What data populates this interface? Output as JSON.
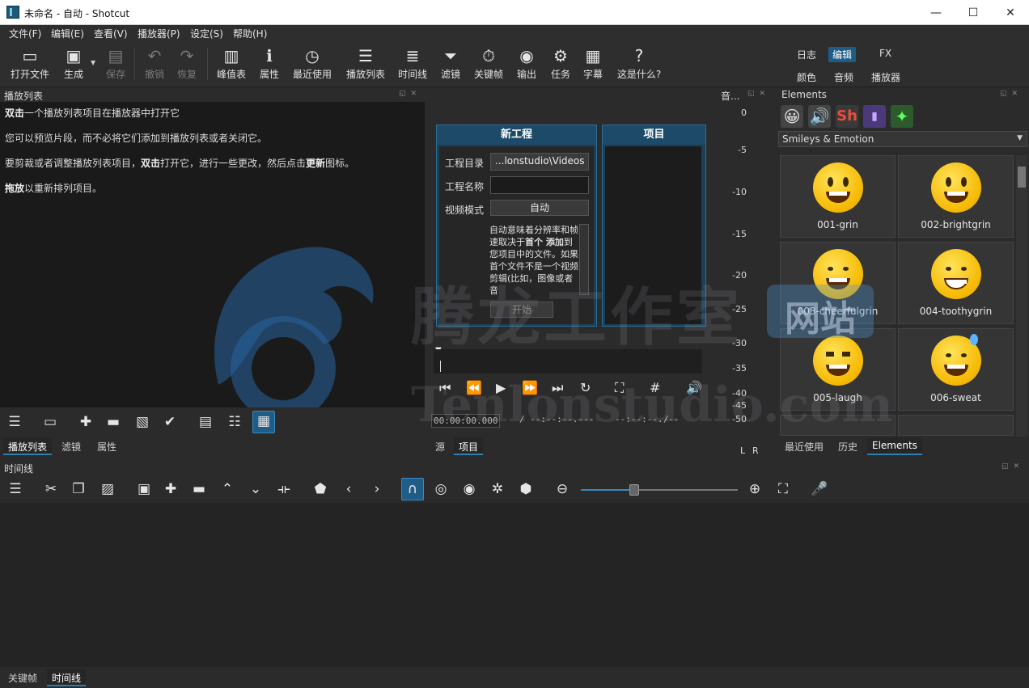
{
  "window": {
    "title": "未命名 - 自动 - Shotcut",
    "controls": [
      "—",
      "☐",
      "✕"
    ]
  },
  "menu": [
    "文件(F)",
    "编辑(E)",
    "查看(V)",
    "播放器(P)",
    "设定(S)",
    "帮助(H)"
  ],
  "toolbar": {
    "buttons": [
      {
        "label": "打开文件",
        "icon": "open-file-icon",
        "enabled": true
      },
      {
        "label": "生成",
        "icon": "generate-icon",
        "enabled": true
      },
      {
        "label": "保存",
        "icon": "save-icon",
        "enabled": false
      },
      {
        "label": "撤销",
        "icon": "undo-icon",
        "enabled": false
      },
      {
        "label": "恢复",
        "icon": "redo-icon",
        "enabled": false
      },
      {
        "label": "峰值表",
        "icon": "peak-meter-icon",
        "enabled": true
      },
      {
        "label": "属性",
        "icon": "properties-icon",
        "enabled": true
      },
      {
        "label": "最近使用",
        "icon": "recent-icon",
        "enabled": true
      },
      {
        "label": "播放列表",
        "icon": "playlist-icon",
        "enabled": true
      },
      {
        "label": "时间线",
        "icon": "timeline-icon",
        "enabled": true
      },
      {
        "label": "滤镜",
        "icon": "filter-icon",
        "enabled": true
      },
      {
        "label": "关键帧",
        "icon": "keyframe-icon",
        "enabled": true
      },
      {
        "label": "输出",
        "icon": "export-icon",
        "enabled": true
      },
      {
        "label": "任务",
        "icon": "jobs-icon",
        "enabled": true
      },
      {
        "label": "字幕",
        "icon": "subtitles-icon",
        "enabled": true
      },
      {
        "label": "这是什么?",
        "icon": "help-icon",
        "enabled": true
      }
    ],
    "layouts_top": [
      "日志",
      "编辑",
      "FX"
    ],
    "layouts_bottom": [
      "颜色",
      "音频",
      "播放器"
    ],
    "active_layout": "编辑"
  },
  "playlist": {
    "title": "播放列表",
    "lines": [
      {
        "bold": "双击",
        "rest": "一个播放列表项目在播放器中打开它"
      },
      {
        "bold": "",
        "rest": "您可以预览片段，而不必将它们添加到播放列表或者关闭它。"
      },
      {
        "pre": "要剪裁或者调整播放列表项目，",
        "bold": "双击",
        "mid": "打开它，进行一些更改，然后点击",
        "bold2": "更新",
        "post": "图标。"
      },
      {
        "bold": "拖放",
        "rest": "以重新排列项目。"
      }
    ],
    "tabs": [
      "播放列表",
      "滤镜",
      "属性"
    ]
  },
  "new_project": {
    "title": "新工程",
    "dir_label": "工程目录",
    "dir_value": "...lonstudio\\Videos",
    "name_label": "工程名称",
    "name_value": "",
    "mode_label": "视频模式",
    "mode_value": "自动",
    "info_text_a": "自动意味着分辨率和帧速取决于",
    "info_bold_a": "首个 添加",
    "info_text_b": "到您项目中的文件。如果首个文件不是一个视频剪辑(比如，图像或者音",
    "start_label": "开始",
    "projects_title": "项目"
  },
  "player": {
    "tabs": [
      "源",
      "项目"
    ],
    "timecode": "00:00:00.000",
    "duration": "--:--:--.---",
    "in_out": "--:--:--.---",
    "slash": "/"
  },
  "meter": {
    "title": "音...",
    "ticks": [
      "0",
      "-5",
      "-10",
      "-15",
      "-20",
      "-25",
      "-30",
      "-35",
      "-40",
      "-45",
      "-50"
    ],
    "channels": [
      "L",
      "R"
    ]
  },
  "elements": {
    "title": "Elements",
    "category": "Smileys & Emotion",
    "items": [
      {
        "name": "001-grin"
      },
      {
        "name": "002-brightgrin"
      },
      {
        "name": "003-cheerfulgrin"
      },
      {
        "name": "004-toothygrin"
      },
      {
        "name": "005-laugh"
      },
      {
        "name": "006-sweat"
      }
    ],
    "tabs": [
      "最近使用",
      "历史",
      "Elements"
    ]
  },
  "timeline": {
    "title": "时间线",
    "tabs": [
      "关键帧",
      "时间线"
    ]
  },
  "watermark": {
    "cn": "腾龙工作室",
    "cn_badge": "网站",
    "en": "Tenlonstudio.com"
  },
  "colors": {
    "accent": "#1f5d86",
    "panel": "#2b2b2b",
    "dark": "#1a1a1a"
  }
}
